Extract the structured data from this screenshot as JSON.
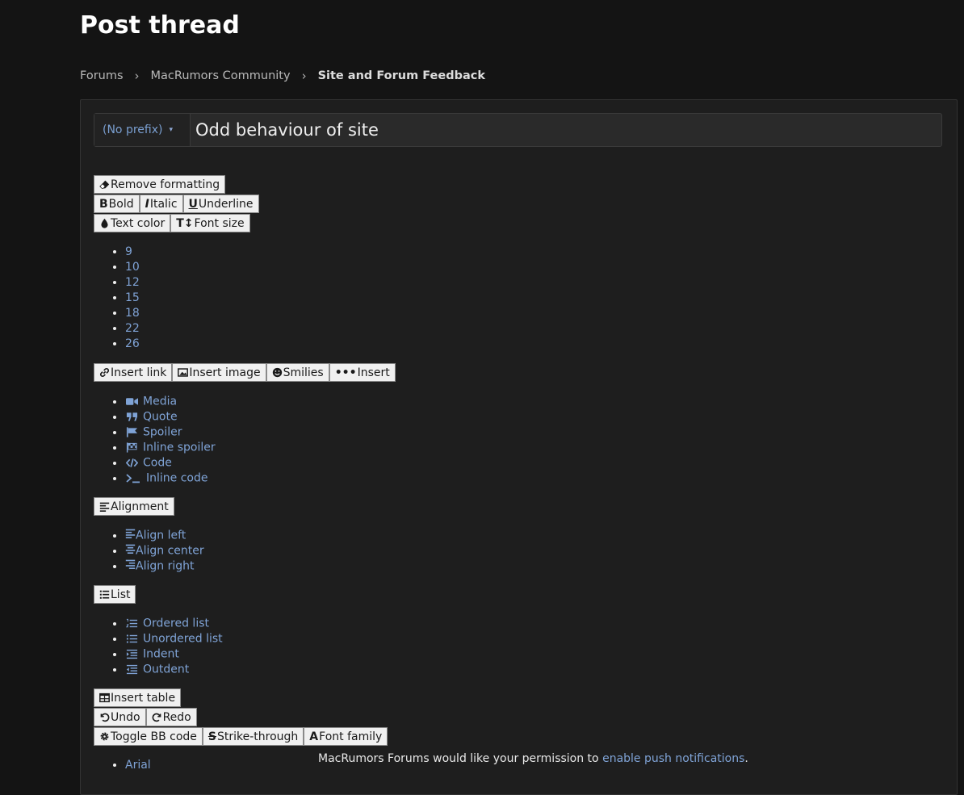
{
  "page": {
    "title": "Post thread"
  },
  "breadcrumb": [
    "Forums",
    "MacRumors Community",
    "Site and Forum Feedback"
  ],
  "thread": {
    "prefix": "(No prefix)",
    "title_value": "Odd behaviour of site"
  },
  "toolbar": {
    "remove_formatting": "Remove formatting",
    "bold": "Bold",
    "italic": "Italic",
    "underline": "Underline",
    "text_color": "Text color",
    "font_size": "Font size",
    "insert_link": "Insert link",
    "insert_image": "Insert image",
    "smilies": "Smilies",
    "insert": "Insert",
    "alignment": "Alignment",
    "list": "List",
    "insert_table": "Insert table",
    "undo": "Undo",
    "redo": "Redo",
    "toggle_bb": "Toggle BB code",
    "strike": "Strike-through",
    "font_family": "Font family"
  },
  "font_sizes": [
    "9",
    "10",
    "12",
    "15",
    "18",
    "22",
    "26"
  ],
  "insert_items": [
    {
      "label": "Media",
      "icon": "video-icon"
    },
    {
      "label": "Quote",
      "icon": "quote-icon"
    },
    {
      "label": "Spoiler",
      "icon": "flag-icon"
    },
    {
      "label": "Inline spoiler",
      "icon": "checkered-flag-icon"
    },
    {
      "label": "Code",
      "icon": "code-icon"
    },
    {
      "label": "Inline code",
      "icon": "terminal-icon"
    }
  ],
  "align_items": [
    "Align left",
    "Align center",
    "Align right"
  ],
  "list_items": [
    "Ordered list",
    "Unordered list",
    "Indent",
    "Outdent"
  ],
  "font_families": [
    "Arial"
  ],
  "notice": {
    "text": "MacRumors Forums would like your permission to ",
    "link": "enable push notifications",
    "end": "."
  }
}
